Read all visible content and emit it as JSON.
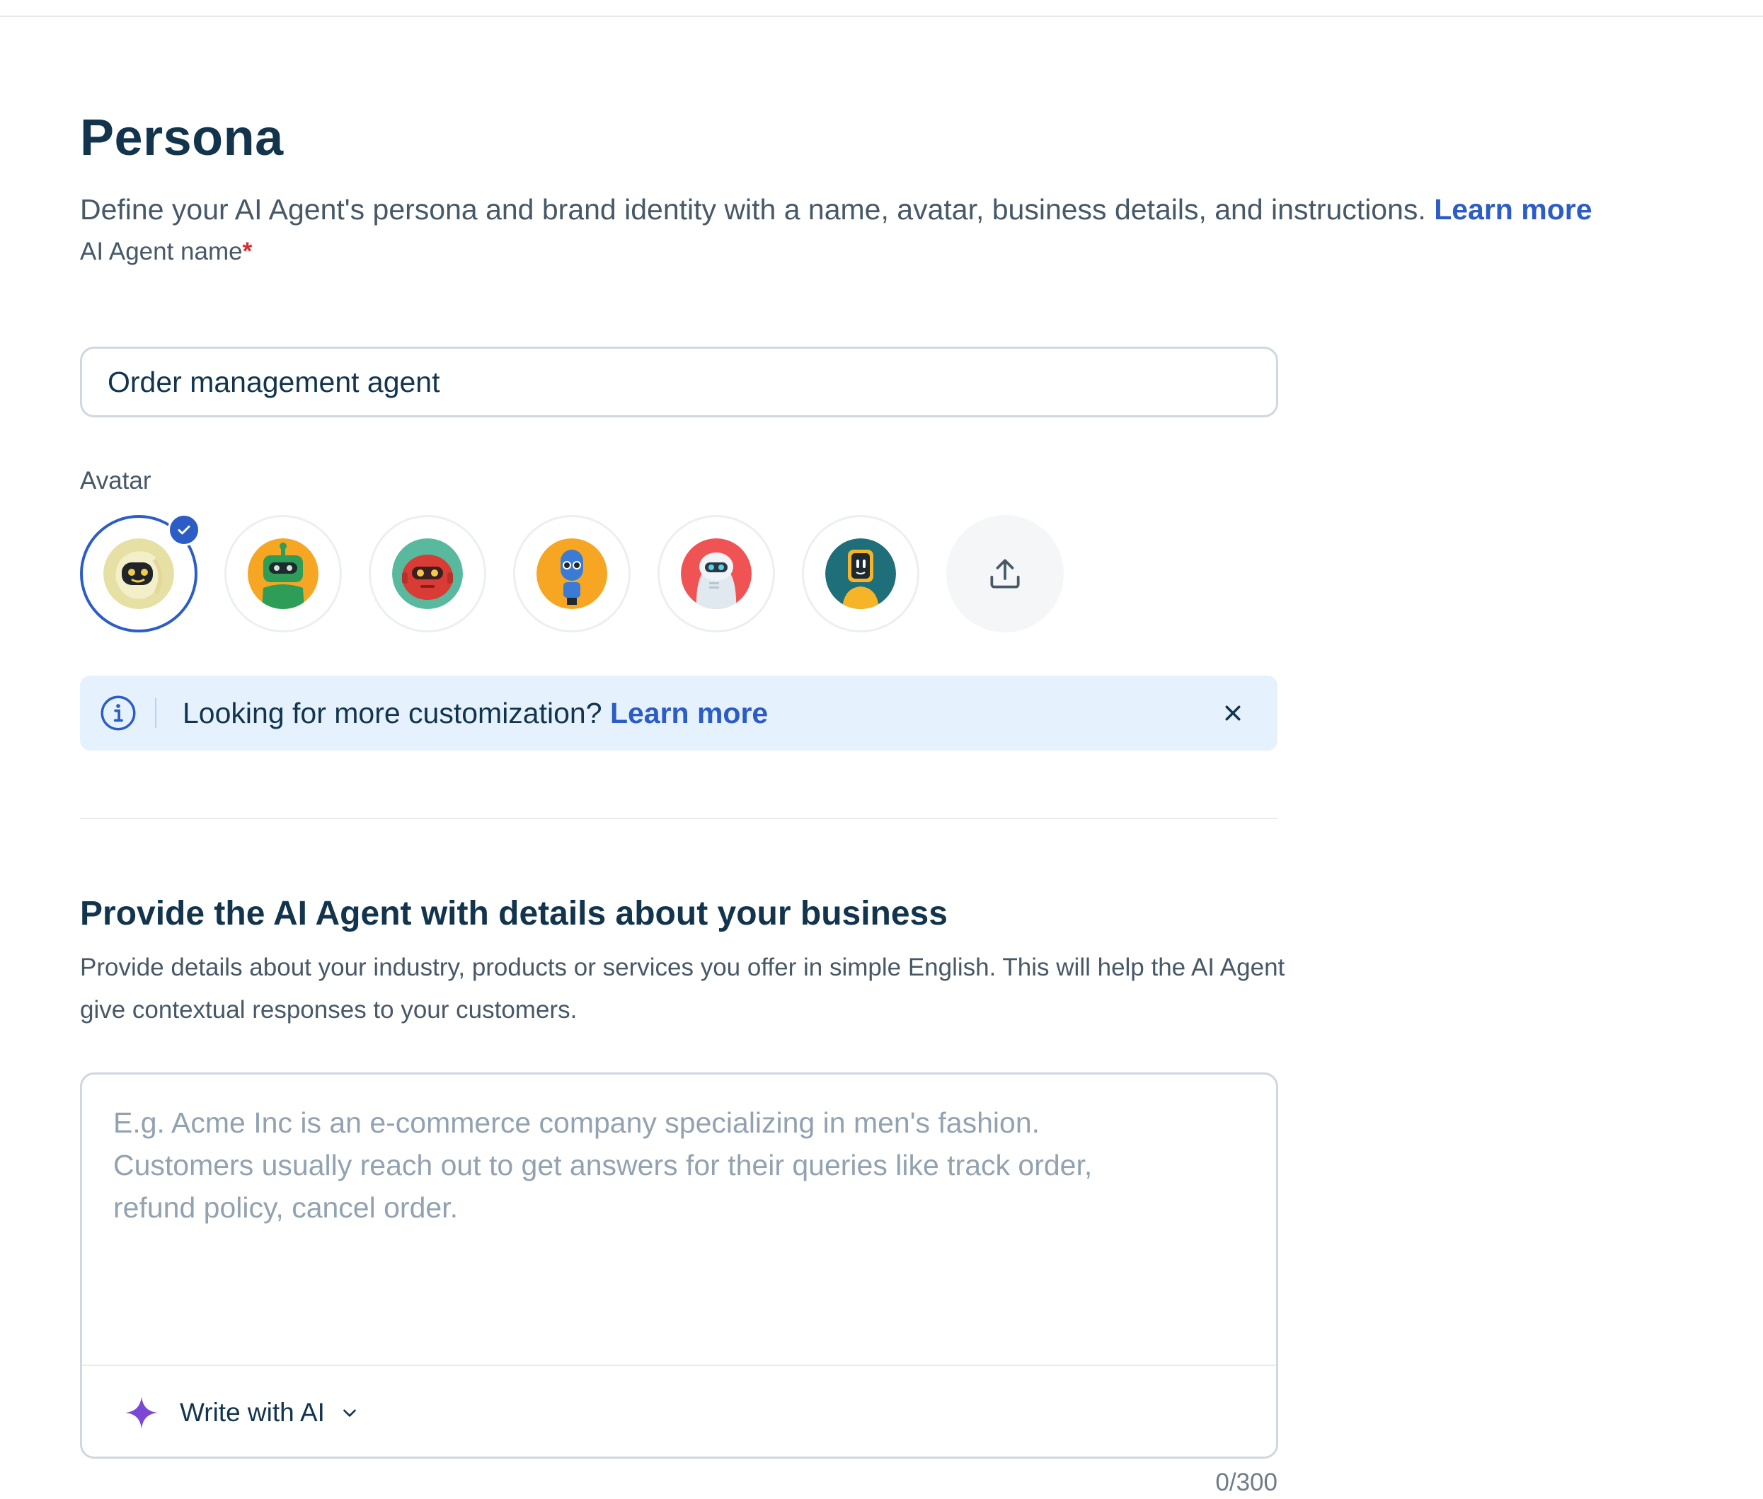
{
  "header": {
    "title": "Persona",
    "description": "Define your AI Agent's persona and brand identity with a name, avatar, business details, and instructions.",
    "learn_more": "Learn more"
  },
  "agent_name": {
    "label": "AI Agent name",
    "required_mark": "*",
    "value": "Order management agent"
  },
  "avatar": {
    "label": "Avatar",
    "selected_index": 0,
    "options": [
      {
        "bg": "#e6e0a4",
        "head": "#1f2428",
        "accent": "#f2c94c"
      },
      {
        "bg": "#f6a623",
        "head": "#2e9d58",
        "accent": "#1e2a30"
      },
      {
        "bg": "#58b99e",
        "head": "#d93b35",
        "accent": "#f2c94c"
      },
      {
        "bg": "#f6a623",
        "head": "#3a7bd5",
        "accent": "#1e2a30"
      },
      {
        "bg": "#f05353",
        "head": "#dfe9ef",
        "accent": "#2a3a45"
      },
      {
        "bg": "#1f6f7a",
        "head": "#f6b429",
        "accent": "#1e2a30"
      }
    ]
  },
  "info_banner": {
    "text": "Looking for more customization?",
    "link": "Learn more"
  },
  "business": {
    "title": "Provide the AI Agent with details about your business",
    "description": "Provide details about your industry, products or services you offer in simple English. This will help the AI Agent give contextual responses to your customers.",
    "value": "",
    "placeholder": "E.g. Acme Inc is an e-commerce company specializing in men's fashion.\nCustomers usually reach out to get answers for their queries like track order,\nrefund policy, cancel order.",
    "write_with_ai": "Write with AI",
    "counter": "0/300"
  },
  "colors": {
    "accent": "#2c5cc5",
    "heading": "#12344d",
    "info_bg": "#e5f2fd",
    "ai_sparkle": "#7b47d4"
  }
}
